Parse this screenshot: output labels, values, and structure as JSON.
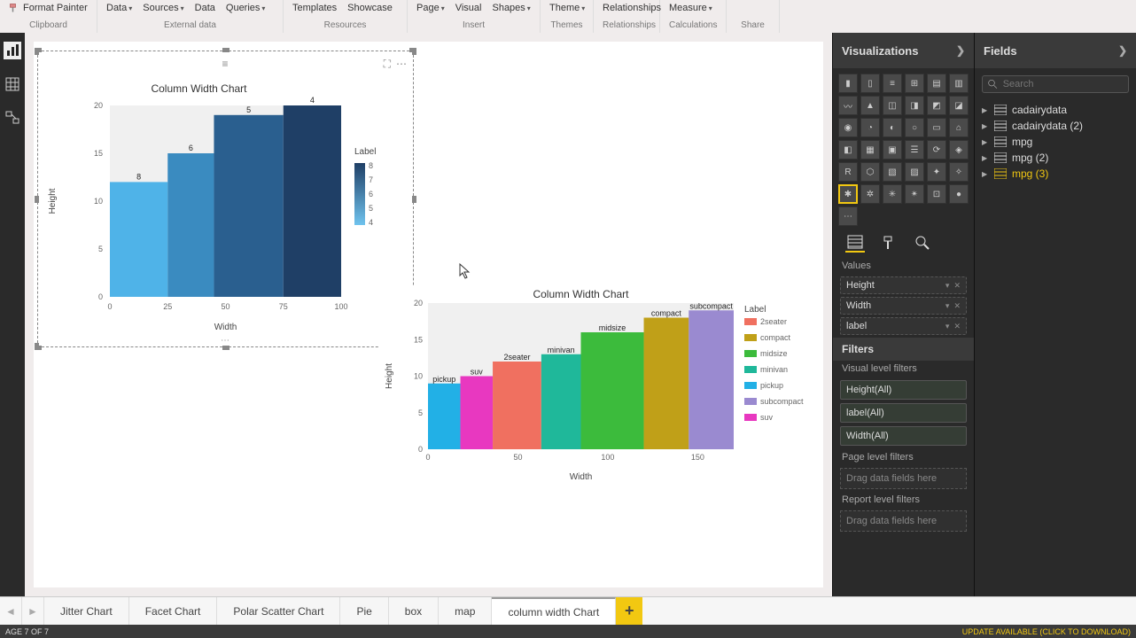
{
  "ribbon": {
    "format_painter": "Format Painter",
    "groups": [
      {
        "label": "Clipboard",
        "items": []
      },
      {
        "label": "External data",
        "items": [
          {
            "t": "Data",
            "caret": true
          },
          {
            "t": "Sources",
            "caret": true
          },
          {
            "t": "Data",
            "caret": false
          },
          {
            "t": "Queries",
            "caret": true
          }
        ]
      },
      {
        "label": "Resources",
        "items": [
          {
            "t": "Templates",
            "caret": false
          },
          {
            "t": "Showcase",
            "caret": false
          }
        ]
      },
      {
        "label": "Insert",
        "items": [
          {
            "t": "Page",
            "caret": true
          },
          {
            "t": "Visual",
            "caret": false
          },
          {
            "t": "Shapes",
            "caret": true
          }
        ]
      },
      {
        "label": "Themes",
        "items": [
          {
            "t": "Theme",
            "caret": true
          }
        ]
      },
      {
        "label": "Relationships",
        "items": [
          {
            "t": "Relationships",
            "caret": false
          }
        ]
      },
      {
        "label": "Calculations",
        "items": [
          {
            "t": "Measure",
            "caret": true
          }
        ]
      },
      {
        "label": "Share",
        "items": []
      }
    ]
  },
  "viz_panel": {
    "title": "Visualizations"
  },
  "fields_panel": {
    "title": "Fields",
    "search_placeholder": "Search",
    "tables": [
      "cadairydata",
      "cadairydata (2)",
      "mpg",
      "mpg (2)",
      "mpg (3)"
    ],
    "selected": "mpg (3)"
  },
  "wells": {
    "values_label": "Values",
    "items": [
      "Height",
      "Width",
      "label"
    ]
  },
  "filters": {
    "title": "Filters",
    "visual_label": "Visual level filters",
    "visual": [
      "Height(All)",
      "label(All)",
      "Width(All)"
    ],
    "page_label": "Page level filters",
    "report_label": "Report level filters",
    "drop_hint": "Drag data fields here"
  },
  "tabs": {
    "pages": [
      "Jitter Chart",
      "Facet Chart",
      "Polar Scatter Chart",
      "Pie",
      "box",
      "map",
      "column width Chart"
    ],
    "active": "column width Chart"
  },
  "status": {
    "left": "AGE 7 OF 7",
    "right": "UPDATE AVAILABLE (CLICK TO DOWNLOAD)"
  },
  "chart_data": [
    {
      "type": "bar",
      "title": "Column Width Chart",
      "xlabel": "Width",
      "ylabel": "Height",
      "xlim": [
        0,
        100
      ],
      "ylim": [
        0,
        20
      ],
      "xticks": [
        0,
        25,
        50,
        75,
        100
      ],
      "yticks": [
        0,
        5,
        10,
        15,
        20
      ],
      "legend_title": "Label",
      "legend_gradient": {
        "min": 4,
        "max": 8,
        "ticks": [
          8,
          7,
          6,
          5,
          4
        ]
      },
      "bars": [
        {
          "x0": 0,
          "x1": 25,
          "height": 12,
          "label": 8,
          "color": "#4fb3e8"
        },
        {
          "x0": 25,
          "x1": 45,
          "height": 15,
          "label": 6,
          "color": "#3a8bc0"
        },
        {
          "x0": 45,
          "x1": 75,
          "height": 19,
          "label": 5,
          "color": "#2a5f8f"
        },
        {
          "x0": 75,
          "x1": 100,
          "height": 20,
          "label": 4,
          "color": "#1f3f66"
        }
      ]
    },
    {
      "type": "bar",
      "title": "Column Width Chart",
      "xlabel": "Width",
      "ylabel": "Height",
      "xlim": [
        0,
        170
      ],
      "ylim": [
        0,
        20
      ],
      "xticks": [
        0,
        50,
        100,
        150
      ],
      "yticks": [
        0,
        5,
        10,
        15,
        20
      ],
      "legend_title": "Label",
      "bars": [
        {
          "x0": 0,
          "x1": 18,
          "height": 9,
          "label": "pickup",
          "color": "#22b0e6"
        },
        {
          "x0": 18,
          "x1": 36,
          "height": 10,
          "label": "suv",
          "color": "#e838c0"
        },
        {
          "x0": 36,
          "x1": 63,
          "height": 12,
          "label": "2seater",
          "color": "#f07060"
        },
        {
          "x0": 63,
          "x1": 85,
          "height": 13,
          "label": "minivan",
          "color": "#1fb89a"
        },
        {
          "x0": 85,
          "x1": 120,
          "height": 16,
          "label": "midsize",
          "color": "#3cbb3c"
        },
        {
          "x0": 120,
          "x1": 145,
          "height": 18,
          "label": "compact",
          "color": "#c0a018"
        },
        {
          "x0": 145,
          "x1": 170,
          "height": 19,
          "label": "subcompact",
          "color": "#9a8ad0"
        }
      ],
      "legend": [
        {
          "label": "2seater",
          "color": "#f07060"
        },
        {
          "label": "compact",
          "color": "#c0a018"
        },
        {
          "label": "midsize",
          "color": "#3cbb3c"
        },
        {
          "label": "minivan",
          "color": "#1fb89a"
        },
        {
          "label": "pickup",
          "color": "#22b0e6"
        },
        {
          "label": "subcompact",
          "color": "#9a8ad0"
        },
        {
          "label": "suv",
          "color": "#e838c0"
        }
      ]
    }
  ]
}
